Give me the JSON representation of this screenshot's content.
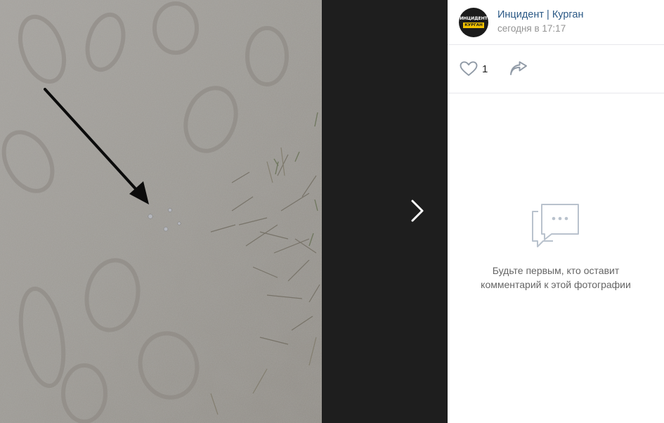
{
  "post": {
    "group_name": "Инцидент | Курган",
    "time": "сегодня в 17:17",
    "avatar_logo_top": "ИНЦИДЕНТ",
    "avatar_logo_bottom": "КУРГАН"
  },
  "actions": {
    "like_count": "1",
    "like_icon": "heart-icon",
    "share_icon": "share-icon"
  },
  "comments": {
    "empty_line1": "Будьте первым, кто оставит",
    "empty_line2": "комментарий к этой фотографии",
    "empty_icon": "comments-icon"
  },
  "viewer": {
    "next_icon": "chevron-right-icon"
  },
  "colors": {
    "link": "#2a5885",
    "muted": "#939393",
    "viewer_bg": "#1e1e1e",
    "icon": "#a7b2c1"
  }
}
